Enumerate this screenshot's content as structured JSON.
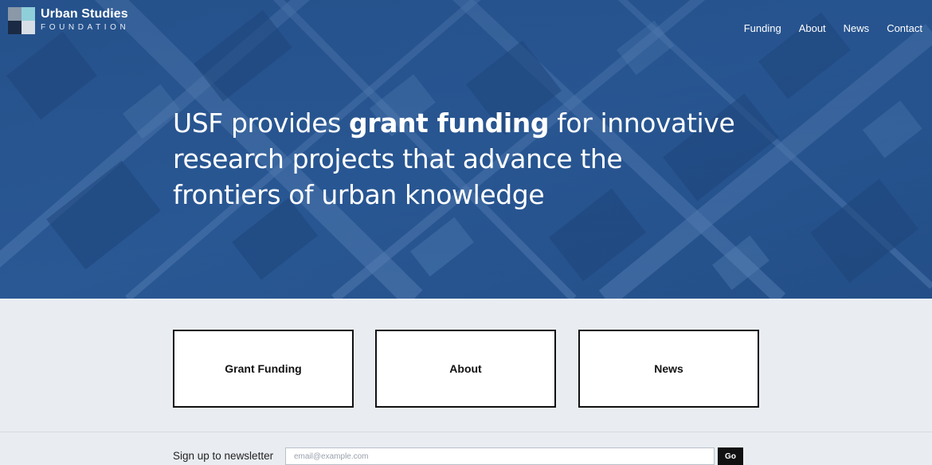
{
  "brand": {
    "name": "Urban Studies",
    "sub": "FOUNDATION",
    "colors": {
      "hero_blue": "#23508a",
      "logo_gray": "#8a98a8",
      "logo_teal": "#8fcfd9",
      "logo_navy": "#1b2a44",
      "logo_light": "#d7dee6"
    }
  },
  "nav": {
    "items": [
      {
        "label": "Funding"
      },
      {
        "label": "About"
      },
      {
        "label": "News"
      },
      {
        "label": "Contact"
      }
    ]
  },
  "hero": {
    "line1_pre": "USF provides ",
    "line1_bold": "grant funding",
    "line1_post": " for innovative",
    "line2": "research projects that advance the",
    "line3": "frontiers of urban knowledge"
  },
  "cards": [
    {
      "label": "Grant Funding"
    },
    {
      "label": "About"
    },
    {
      "label": "News"
    }
  ],
  "newsletter": {
    "label": "Sign up to newsletter",
    "placeholder": "email@example.com",
    "button": "Go"
  }
}
